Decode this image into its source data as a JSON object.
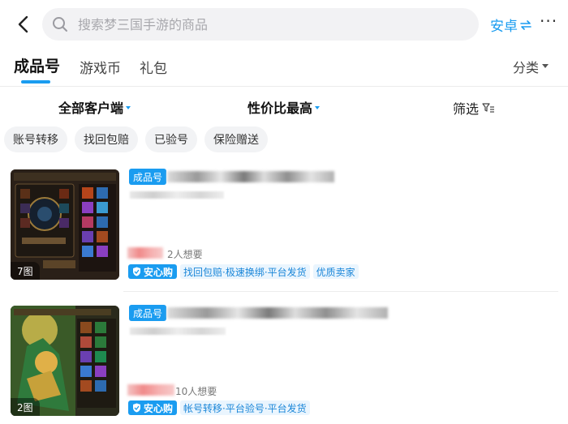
{
  "search": {
    "placeholder": "搜索梦三国手游的商品"
  },
  "header": {
    "platform": "安卓",
    "more": "···"
  },
  "tabs": [
    {
      "label": "成品号",
      "active": true
    },
    {
      "label": "游戏币",
      "active": false
    },
    {
      "label": "礼包",
      "active": false
    }
  ],
  "category": {
    "label": "分类"
  },
  "sort": {
    "client": "全部客户端",
    "order": "性价比最高",
    "filter": "筛选"
  },
  "chips": [
    "账号转移",
    "找回包赔",
    "已验号",
    "保险赠送"
  ],
  "listings": [
    {
      "type_tag": "成品号",
      "image_count": "7图",
      "want": "2人想要",
      "secure_label": "安心购",
      "features": "找回包赔·极速换绑·平台发货",
      "seller_tag": "优质卖家"
    },
    {
      "type_tag": "成品号",
      "image_count": "2图",
      "want": "10人想要",
      "secure_label": "安心购",
      "features": "帐号转移·平台验号·平台发货",
      "seller_tag": ""
    }
  ],
  "colors": {
    "accent": "#1a9cf0",
    "price_blur": "#f08a8a"
  },
  "icons": [
    "back-arrow-icon",
    "search-icon",
    "switch-icon",
    "more-icon",
    "dropdown-caret-icon",
    "filter-icon",
    "shield-check-icon"
  ]
}
